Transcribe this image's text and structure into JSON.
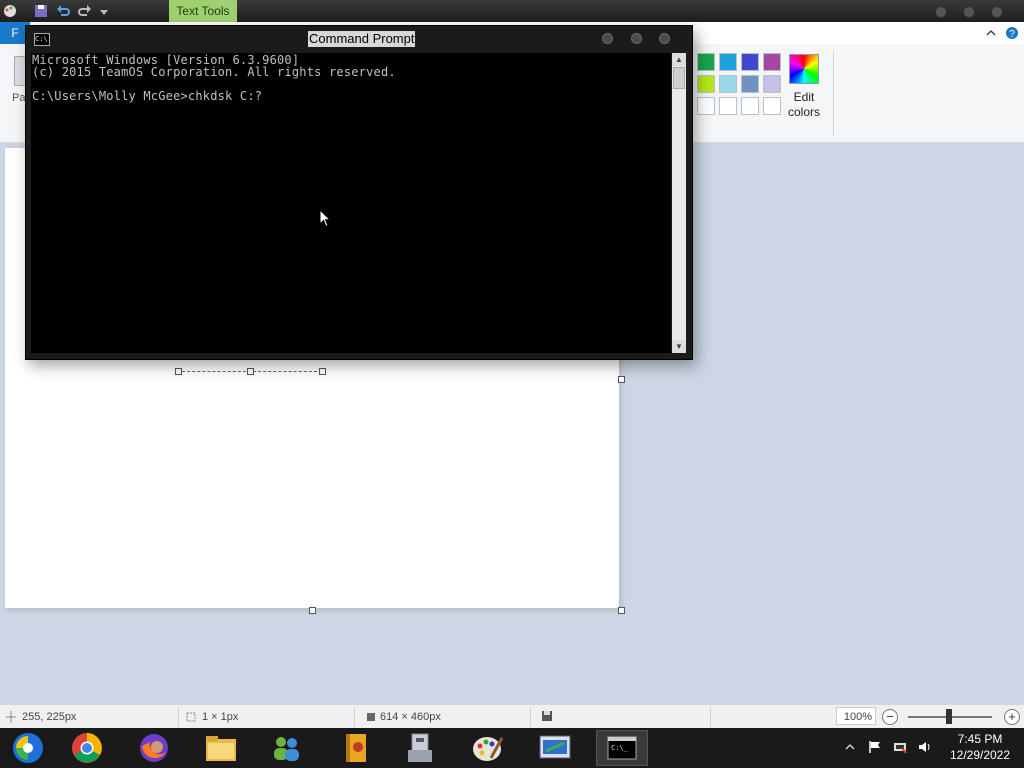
{
  "paint": {
    "file_tab_label": "F",
    "contextual_tab_label": "Text Tools",
    "paste_label": "Pa",
    "edit_colors_label": "Edit\ncolors",
    "palette_colors": [
      [
        "#1aa34a",
        "#1ea0dc",
        "#3f48cc",
        "#a349a4"
      ],
      [
        "#b5e61d",
        "#99d9ea",
        "#7092be",
        "#c8bfe7"
      ],
      [
        "#ffffff",
        "#ffffff",
        "#ffffff",
        "#ffffff"
      ]
    ]
  },
  "cmd": {
    "title": "Command Prompt",
    "lines": [
      "Microsoft Windows [Version 6.3.9600]",
      "(c) 2015 TeamOS Corporation. All rights reserved.",
      "",
      "C:\\Users\\Molly McGee>chkdsk C:?"
    ]
  },
  "statusbar": {
    "cursor_pos": "255, 225px",
    "selection_size": "1 × 1px",
    "image_size": "614 × 460px",
    "zoom": "100%"
  },
  "taskbar": {
    "apps": [
      "media-center",
      "chrome",
      "firefox",
      "file-explorer",
      "messenger",
      "archive-viewer",
      "system-tool",
      "paint",
      "remote-desktop",
      "command-prompt"
    ],
    "time": "7:45 PM",
    "date": "12/29/2022"
  }
}
